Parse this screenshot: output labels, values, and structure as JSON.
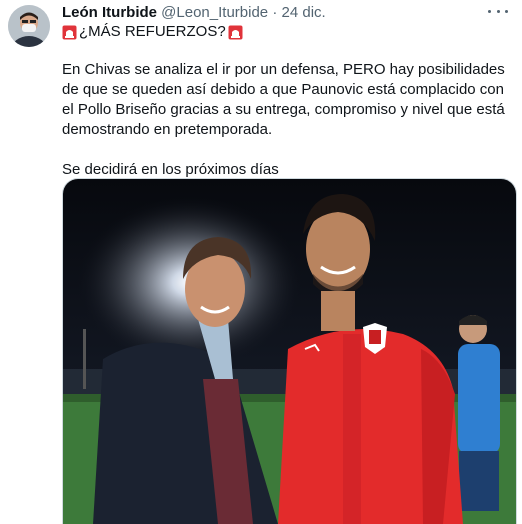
{
  "tweet": {
    "author_name": "León Iturbide",
    "handle": "@Leon_Iturbide",
    "separator": "·",
    "date": "24 dic.",
    "headline": "¿MÁS REFUERZOS?",
    "paragraphs": [
      "En Chivas se analiza el ir por un defensa, PERO hay posibilidades de que se queden así debido a que Paunovic está complacido con el Pollo Briseño gracias a su entrega, compromiso y nivel que está demostrando en pretemporada.",
      "Se decidirá en los próximos días"
    ]
  },
  "icons": {
    "more": "more-options-icon",
    "siren": "rotating-light-icon"
  },
  "colors": {
    "text": "#0f1419",
    "secondary": "#536471",
    "jersey_red": "#e32b2b",
    "siren_red": "#e0333a"
  }
}
